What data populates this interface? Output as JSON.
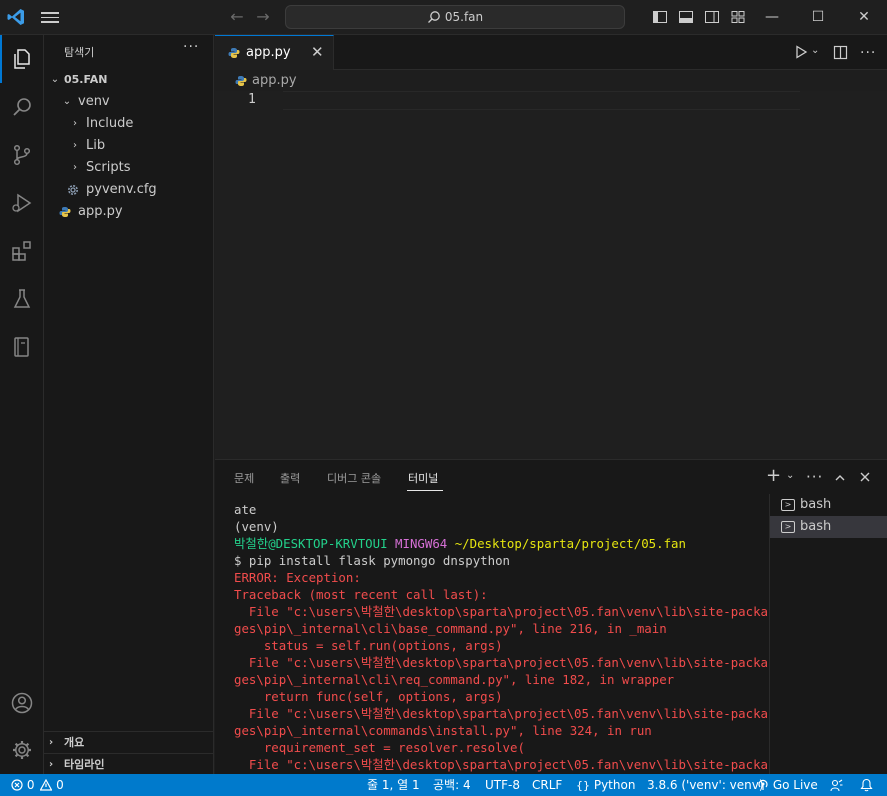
{
  "titlebar": {
    "search_text": "05.fan",
    "back_icon": "arrow-left-icon",
    "forward_icon": "arrow-right-icon",
    "minimize": "—",
    "maximize": "☐",
    "close": "✕"
  },
  "activity_bar": {
    "items": [
      "explorer-icon",
      "search-icon",
      "source-control-icon",
      "run-debug-icon",
      "extensions-icon",
      "testing-icon",
      "notebook-icon"
    ],
    "bottom": [
      "account-icon",
      "settings-icon"
    ]
  },
  "sidebar": {
    "title": "탐색기",
    "more": "···",
    "root": "05.FAN",
    "tree": [
      {
        "label": "venv",
        "chevron": "⌄"
      },
      {
        "label": "Include",
        "chevron": "›"
      },
      {
        "label": "Lib",
        "chevron": "›"
      },
      {
        "label": "Scripts",
        "chevron": "›"
      },
      {
        "label": "pyvenv.cfg",
        "icon": "gear-icon"
      },
      {
        "label": "app.py",
        "icon": "python-icon"
      }
    ],
    "sections": [
      "개요",
      "타임라인"
    ]
  },
  "editor": {
    "tab_label": "app.py",
    "tab_close": "✕",
    "breadcrumb": "app.py",
    "line_number": "1"
  },
  "panel": {
    "tabs": [
      "문제",
      "출력",
      "디버그 콘솔",
      "터미널"
    ],
    "active_tab": "터미널",
    "terminal_lines": [
      {
        "text": "ate",
        "color": "default"
      },
      {
        "text": "(venv)",
        "color": "default"
      },
      {
        "user": "박철한@DESKTOP-KRVTOUI",
        "host": " MINGW64",
        "path": " ~/Desktop/sparta/project/05.fan"
      },
      {
        "text": "$ pip install flask pymongo dnspython",
        "color": "default"
      },
      {
        "text": "ERROR: Exception:",
        "color": "red"
      },
      {
        "text": "Traceback (most recent call last):",
        "color": "red"
      },
      {
        "text": "  File \"c:\\users\\박철한\\desktop\\sparta\\project\\05.fan\\venv\\lib\\site-packa",
        "color": "red"
      },
      {
        "text": "ges\\pip\\_internal\\cli\\base_command.py\", line 216, in _main",
        "color": "red"
      },
      {
        "text": "    status = self.run(options, args)",
        "color": "red"
      },
      {
        "text": "  File \"c:\\users\\박철한\\desktop\\sparta\\project\\05.fan\\venv\\lib\\site-packa",
        "color": "red"
      },
      {
        "text": "ges\\pip\\_internal\\cli\\req_command.py\", line 182, in wrapper",
        "color": "red"
      },
      {
        "text": "    return func(self, options, args)",
        "color": "red"
      },
      {
        "text": "  File \"c:\\users\\박철한\\desktop\\sparta\\project\\05.fan\\venv\\lib\\site-packa",
        "color": "red"
      },
      {
        "text": "ges\\pip\\_internal\\commands\\install.py\", line 324, in run",
        "color": "red"
      },
      {
        "text": "    requirement_set = resolver.resolve(",
        "color": "red"
      },
      {
        "text": "  File \"c:\\users\\박철한\\desktop\\sparta\\project\\05.fan\\venv\\lib\\site-packa",
        "color": "red"
      }
    ],
    "terminals": [
      "bash",
      "bash"
    ]
  },
  "statusbar": {
    "errors": "0",
    "warnings": "0",
    "position": "줄 1, 열 1",
    "spaces": "공백: 4",
    "encoding": "UTF-8",
    "eol": "CRLF",
    "language": "Python",
    "interpreter": "3.8.6 ('venv': venv)",
    "golive": "Go Live"
  },
  "colors": {
    "accent": "#0078d4",
    "statusbar": "#007acc",
    "terminal_red": "#f14c4c",
    "terminal_green": "#23d18b",
    "terminal_magenta": "#d670d6",
    "terminal_yellow": "#e5e510"
  }
}
